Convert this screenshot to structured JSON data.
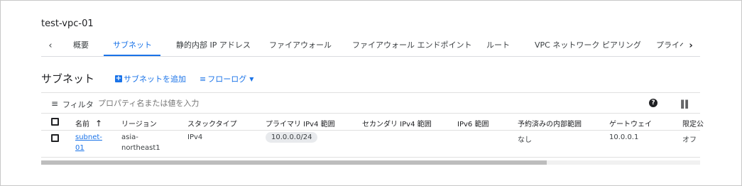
{
  "page": {
    "title": "test-vpc-01"
  },
  "tabs": [
    {
      "label": "概要"
    },
    {
      "label": "サブネット"
    },
    {
      "label": "静的内部 IP アドレス"
    },
    {
      "label": "ファイアウォール"
    },
    {
      "label": "ファイアウォール エンドポイント"
    },
    {
      "label": "ルート"
    },
    {
      "label": "VPC ネットワーク ピアリング"
    },
    {
      "label": "プライベ"
    }
  ],
  "tab_nav": {
    "left_icon": "chevron-left-icon",
    "right_icon": "chevron-right-icon"
  },
  "section": {
    "title": "サブネット",
    "add_subnet_label": "サブネットを追加",
    "flow_log_label": "フローログ"
  },
  "filter": {
    "label": "フィルタ",
    "placeholder": "プロパティ名または値を入力"
  },
  "table": {
    "headers": {
      "name": "名前",
      "region": "リージョン",
      "stack_type": "スタックタイプ",
      "primary_ipv4": "プライマリ IPv4 範囲",
      "secondary_ipv4": "セカンダリ IPv4 範囲",
      "ipv6": "IPv6 範囲",
      "reserved_internal": "予約済みの内部範囲",
      "gateway": "ゲートウェイ",
      "limited": "限定公"
    },
    "rows": [
      {
        "name_line1": "subnet-",
        "name_line2": "01",
        "region_line1": "asia-",
        "region_line2": "northeast1",
        "stack_type": "IPv4",
        "primary_ipv4": "10.0.0.0/24",
        "secondary_ipv4": "",
        "ipv6": "",
        "reserved_internal": "なし",
        "gateway": "10.0.0.1",
        "limited": "オフ"
      }
    ]
  },
  "colors": {
    "accent": "#1a73e8",
    "border": "#e0e0e0",
    "chip": "#e8eaed"
  }
}
